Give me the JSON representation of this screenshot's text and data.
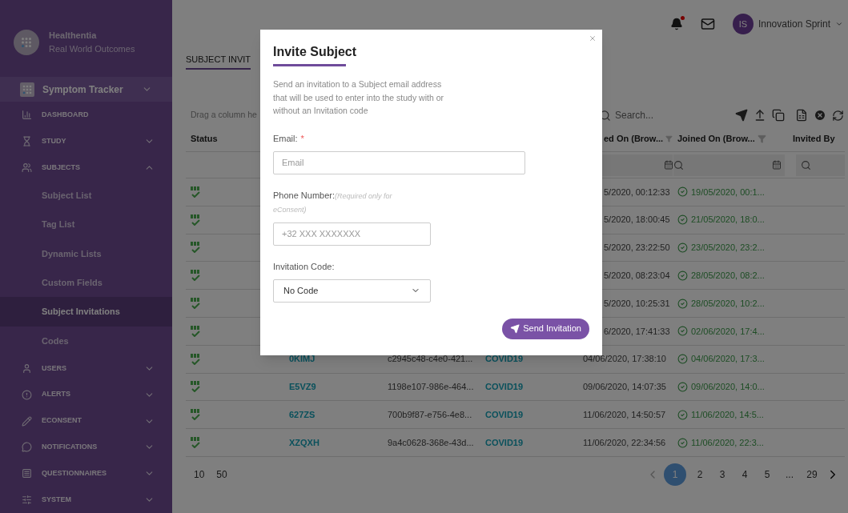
{
  "sidebar": {
    "brand": {
      "name": "Healthentia",
      "tagline": "Real World Outcomes"
    },
    "project": {
      "label": "Symptom Tracker",
      "expanded": false
    },
    "items": [
      {
        "label": "DASHBOARD"
      },
      {
        "label": "STUDY",
        "expanded": false
      },
      {
        "label": "SUBJECTS",
        "expanded": true,
        "children": [
          {
            "label": "Subject List",
            "selected": false
          },
          {
            "label": "Tag List",
            "selected": false
          },
          {
            "label": "Dynamic Lists",
            "selected": false
          },
          {
            "label": "Custom Fields",
            "selected": false
          },
          {
            "label": "Subject Invitations",
            "selected": true
          },
          {
            "label": "Codes",
            "selected": false
          }
        ]
      },
      {
        "label": "USERS",
        "expanded": false
      },
      {
        "label": "ALERTS",
        "expanded": false
      },
      {
        "label": "ECONSENT",
        "expanded": false
      },
      {
        "label": "NOTIFICATIONS",
        "expanded": false
      },
      {
        "label": "QUESTIONNAIRES",
        "expanded": false
      },
      {
        "label": "SYSTEM",
        "expanded": false
      }
    ]
  },
  "topbar": {
    "user": {
      "initials": "IS",
      "name": "Innovation Sprint"
    }
  },
  "page": {
    "tab": "SUBJECT INVIT",
    "group_hint": "Drag a column he",
    "search": {
      "placeholder": "Search..."
    }
  },
  "table": {
    "columns": [
      {
        "label": "Status"
      },
      {
        "label": "ed On (Brow..."
      },
      {
        "label": "Joined On (Brow..."
      },
      {
        "label": "Invited By"
      }
    ],
    "rows": [
      {
        "invited_on": "5/2020, 00:12:33",
        "joined_on": "19/05/2020, 00:1..."
      },
      {
        "invited_on": "5/2020, 18:00:45",
        "joined_on": "21/05/2020, 18:0..."
      },
      {
        "invited_on": "5/2020, 23:22:50",
        "joined_on": "23/05/2020, 23:2..."
      },
      {
        "invited_on": "5/2020, 08:23:04",
        "joined_on": "28/05/2020, 08:2..."
      },
      {
        "invited_on": "5/2020, 10:25:31",
        "joined_on": "28/05/2020, 10:2..."
      },
      {
        "invited_on": "6/2020, 17:41:33",
        "joined_on": "02/06/2020, 17:4..."
      },
      {
        "code": "0KIMJ",
        "id": "c2945c48-c4e0-421...",
        "study": "COVID19",
        "invited_on": "04/06/2020, 17:38:10",
        "joined_on": "04/06/2020, 17:3..."
      },
      {
        "code": "E5VZ9",
        "id": "1198e107-986e-464...",
        "study": "COVID19",
        "invited_on": "09/06/2020, 14:07:35",
        "joined_on": "09/06/2020, 14:0..."
      },
      {
        "code": "627ZS",
        "id": "700b9f87-e756-4e8...",
        "study": "COVID19",
        "invited_on": "11/06/2020, 14:50:57",
        "joined_on": "11/06/2020, 14:5..."
      },
      {
        "code": "XZQXH",
        "id": "9a4c0628-368e-43d...",
        "study": "COVID19",
        "invited_on": "11/06/2020, 22:34:56",
        "joined_on": "11/06/2020, 22:3..."
      }
    ]
  },
  "pagination": {
    "page_sizes": [
      "10",
      "50"
    ],
    "pages": [
      {
        "label": "1",
        "selected": true
      },
      {
        "label": "2",
        "selected": false
      },
      {
        "label": "3",
        "selected": false
      },
      {
        "label": "4",
        "selected": false
      },
      {
        "label": "5",
        "selected": false
      },
      {
        "label": "...",
        "selected": false
      },
      {
        "label": "29",
        "selected": false
      }
    ]
  },
  "modal": {
    "title": "Invite Subject",
    "description": "Send an invitation to a Subject email address that will be used to enter into the study with or without an Invitation code",
    "fields": [
      {
        "kind": "input",
        "label": "Email:",
        "required_mark": "*",
        "placeholder": "Email"
      },
      {
        "kind": "input",
        "label": "Phone Number:",
        "note": "(Required only for eConsent)",
        "placeholder": "+32 XXX XXXXXXX"
      },
      {
        "kind": "select",
        "label": "Invitation Code:",
        "value": "No Code"
      }
    ],
    "submit": "Send Invitation"
  }
}
